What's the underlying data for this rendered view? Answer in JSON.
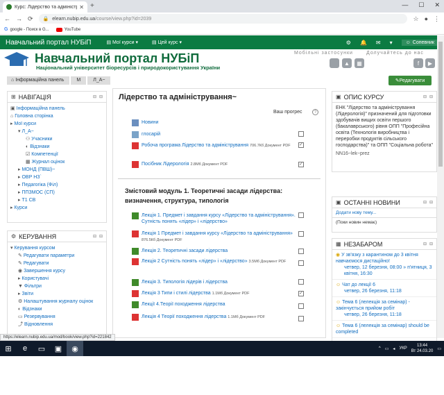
{
  "browser": {
    "tab_title": "Курс: Лідерство та адмініструва",
    "url_domain": "elearn.nubip.edu.ua",
    "url_path": "/course/view.php?id=2039",
    "bookmarks": [
      "google - Поиск в G...",
      "YouTube"
    ],
    "status_url": "https://elearn.nubip.edu.ua/mod/book/view.php?id=221842"
  },
  "nav": {
    "brand": "Навчальний портал НУБіП",
    "my_courses": "Мої курси",
    "this_course": "Цей курс",
    "user": "Сопевник"
  },
  "header": {
    "title": "Навчальний портал НУБіП",
    "subtitle": "Національний університет біоресурсів і природокористування України",
    "mobile_apps": "Мобільні застосунки",
    "join_us": "Долучайтесь до нас"
  },
  "breadcrumb": [
    "Інформаційна панель",
    "М",
    "Л_А~"
  ],
  "edit_button": "Редагувати",
  "navigation": {
    "title": "НАВІГАЦІЯ",
    "items": [
      {
        "label": "Інформаційна панель",
        "level": 0
      },
      {
        "label": "Головна сторінка",
        "level": 0
      },
      {
        "label": "Мої курси",
        "level": 0
      },
      {
        "label": "Л_А~",
        "level": 1
      },
      {
        "label": "Учасники",
        "level": 2
      },
      {
        "label": "Відзнаки",
        "level": 2
      },
      {
        "label": "Компетенції",
        "level": 2
      },
      {
        "label": "Журнал оцінок",
        "level": 2
      },
      {
        "label": "МОНД (ПВШ)~",
        "level": 1
      },
      {
        "label": "ОВР НЗ`",
        "level": 1
      },
      {
        "label": "Педагогіка (Філ)",
        "level": 1
      },
      {
        "label": "ППЗМОС (СП)",
        "level": 1
      },
      {
        "label": "Т1 СВ",
        "level": 1
      },
      {
        "label": "Курси",
        "level": 0
      }
    ]
  },
  "management": {
    "title": "КЕРУВАННЯ",
    "items": [
      {
        "label": "Керування курсом",
        "level": 0
      },
      {
        "label": "Редагувати параметри",
        "level": 1
      },
      {
        "label": "Редагувати",
        "level": 1
      },
      {
        "label": "Завершення курсу",
        "level": 1
      },
      {
        "label": "Користувачі",
        "level": 1
      },
      {
        "label": "Фільтри",
        "level": 1
      },
      {
        "label": "Звіти",
        "level": 1
      },
      {
        "label": "Налаштування журналу оцінок",
        "level": 1
      },
      {
        "label": "Відзнаки",
        "level": 1
      },
      {
        "label": "Резервування",
        "level": 1
      },
      {
        "label": "Відновлення",
        "level": 1
      }
    ]
  },
  "course": {
    "title": "Лідерство та адміністрування~",
    "progress_label": "Ваш прогрес",
    "top_activities": [
      {
        "name": "Новини",
        "meta": "",
        "icon": "forum-icon",
        "check": "none"
      },
      {
        "name": "глосарій",
        "meta": "",
        "icon": "glossary-icon",
        "check": "empty"
      },
      {
        "name": "Робоча програма Лідерство та адміністрування",
        "meta": "706.7Кб Документ PDF",
        "icon": "pdf-icon",
        "check": "done"
      },
      {
        "name": "Посібник Лідерологія",
        "meta": "2.8Мб Документ PDF",
        "icon": "pdf-icon",
        "check": "done"
      }
    ],
    "section_title": "Змістовий модуль 1. Теоретичні засади лідерства: визначення, структура, типологія",
    "section_activities": [
      {
        "name": "Лекція 1. Предмет і завдання курсу «Лідерство та адміністрування». Сутність понять «лідер» і «лідерство»",
        "meta": "",
        "icon": "book-icon",
        "check": "empty"
      },
      {
        "name": "Лекція 1 Предмет і завдання курсу «Лідерство та адміністрування»",
        "meta": "876.5Кб Документ PDF",
        "icon": "pdf-icon",
        "check": "empty"
      },
      {
        "name": "Лекція 2. Теоретичні засади лідерства",
        "meta": "",
        "icon": "book-icon",
        "check": "empty"
      },
      {
        "name": "Лекція 2 Сутність понять «лідер» і «лідерство»",
        "meta": "3.5Мб Документ PDF",
        "icon": "pdf-icon",
        "check": "empty"
      },
      {
        "name": "Лекція 3. Типологія лідерів і лідерства",
        "meta": "",
        "icon": "book-icon",
        "check": "empty"
      },
      {
        "name": "Лекція 3 Типи і стилі лідерства",
        "meta": "1.1Мб Документ PDF",
        "icon": "pdf-icon",
        "check": "done"
      },
      {
        "name": "Лекції 4.Теорії походження лідерства",
        "meta": "",
        "icon": "book-icon",
        "check": "empty"
      },
      {
        "name": "Лекція 4 Теорії походження лідерства",
        "meta": "1.1Мб Документ PDF",
        "icon": "pdf-icon",
        "check": "empty"
      }
    ]
  },
  "description": {
    "title": "ОПИС КУРСУ",
    "text": "ЕНК \"Лідерство та адміністрування (Лідерологія)\" призначений для підготовки здобувачів вищих освіти першого (бакалаврського) рівня ОПП \"Професійна освіта (Технологія виробництва і переробки продуктів сільського господарства)\" та ОПП \"Соціальна робота\"",
    "short": "NN16~lek~prez"
  },
  "news": {
    "title": "ОСТАННІ НОВИНИ",
    "add": "Додати нову тему...",
    "empty": "(Поки новин немає)"
  },
  "upcoming": {
    "title": "НЕЗАБАРОМ",
    "events": [
      {
        "title": "У зв'язку з карантином до 3 квітня навчаємося дистаційно!",
        "date": "четвер, 12 березня, 08:00 » п'ятниця, 3 квітня, 16:30"
      },
      {
        "title": "Чат до лекції 6",
        "date": "четвер, 26 березня, 11:18"
      },
      {
        "title": "Тема 6 (лелекція за семінар) - закінчується прийом робіт",
        "date": "четвер, 26 березня, 11:18"
      },
      {
        "title": "Тема 6 (лелекція за семінар) should be completed",
        "date": ""
      }
    ]
  },
  "taskbar": {
    "lang": "УКР",
    "time": "13:44",
    "date": "Вт 24.03.20"
  }
}
